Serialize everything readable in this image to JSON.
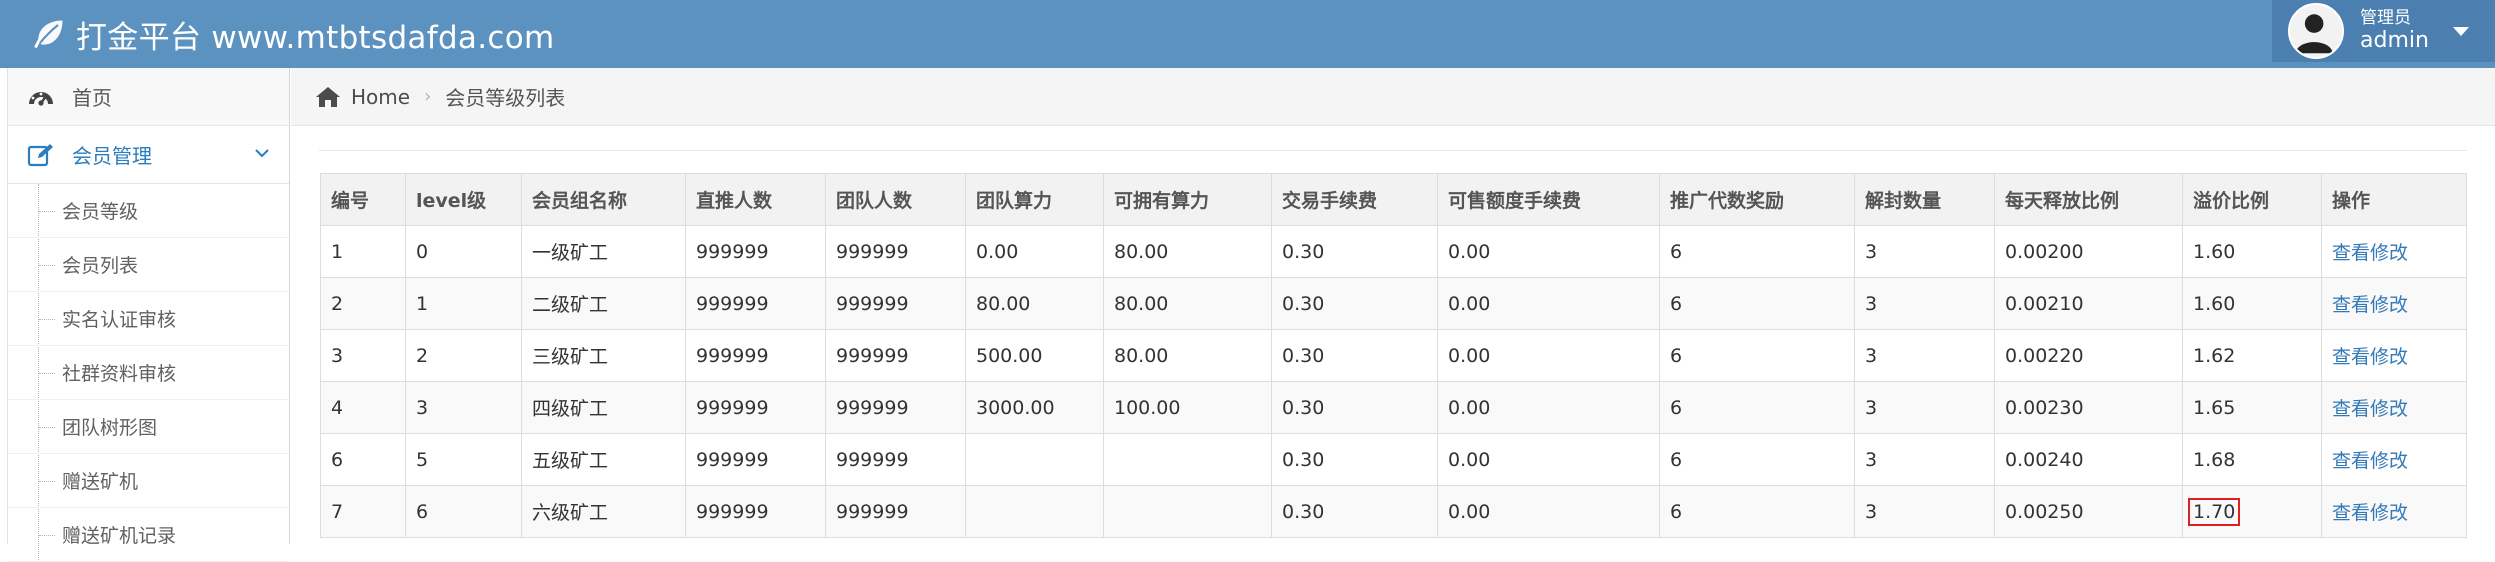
{
  "header": {
    "brand": "打金平台 www.mtbtsdafda.com",
    "user_role": "管理员",
    "user_name": "admin"
  },
  "sidebar": {
    "items": [
      {
        "label": "首页",
        "icon": "dashboard-icon"
      },
      {
        "label": "会员管理",
        "icon": "edit-icon",
        "active": true
      }
    ],
    "submenu": [
      "会员等级",
      "会员列表",
      "实名认证审核",
      "社群资料审核",
      "团队树形图",
      "赠送矿机",
      "赠送矿机记录"
    ]
  },
  "breadcrumb": {
    "home": "Home",
    "current": "会员等级列表"
  },
  "table": {
    "headers": [
      "编号",
      "level级",
      "会员组名称",
      "直推人数",
      "团队人数",
      "团队算力",
      "可拥有算力",
      "交易手续费",
      "可售额度手续费",
      "推广代数奖励",
      "解封数量",
      "每天释放比例",
      "溢价比例",
      "操作"
    ],
    "rows": [
      [
        "1",
        "0",
        "一级矿工",
        "999999",
        "999999",
        "0.00",
        "80.00",
        "0.30",
        "0.00",
        "6",
        "3",
        "0.00200",
        "1.60",
        "查看修改"
      ],
      [
        "2",
        "1",
        "二级矿工",
        "999999",
        "999999",
        "80.00",
        "80.00",
        "0.30",
        "0.00",
        "6",
        "3",
        "0.00210",
        "1.60",
        "查看修改"
      ],
      [
        "3",
        "2",
        "三级矿工",
        "999999",
        "999999",
        "500.00",
        "80.00",
        "0.30",
        "0.00",
        "6",
        "3",
        "0.00220",
        "1.62",
        "查看修改"
      ],
      [
        "4",
        "3",
        "四级矿工",
        "999999",
        "999999",
        "3000.00",
        "100.00",
        "0.30",
        "0.00",
        "6",
        "3",
        "0.00230",
        "1.65",
        "查看修改"
      ],
      [
        "6",
        "5",
        "五级矿工",
        "999999",
        "999999",
        "",
        "",
        "0.30",
        "0.00",
        "6",
        "3",
        "0.00240",
        "1.68",
        "查看修改"
      ],
      [
        "7",
        "6",
        "六级矿工",
        "999999",
        "999999",
        "",
        "",
        "0.30",
        "0.00",
        "6",
        "3",
        "0.00250",
        "1.70",
        "查看修改"
      ]
    ]
  },
  "colors": {
    "navbar": "#5c92c0",
    "user_box": "#4a7fb0",
    "active_text": "#2b7dbc",
    "link": "#337ab7",
    "highlight_border": "#e02020"
  }
}
